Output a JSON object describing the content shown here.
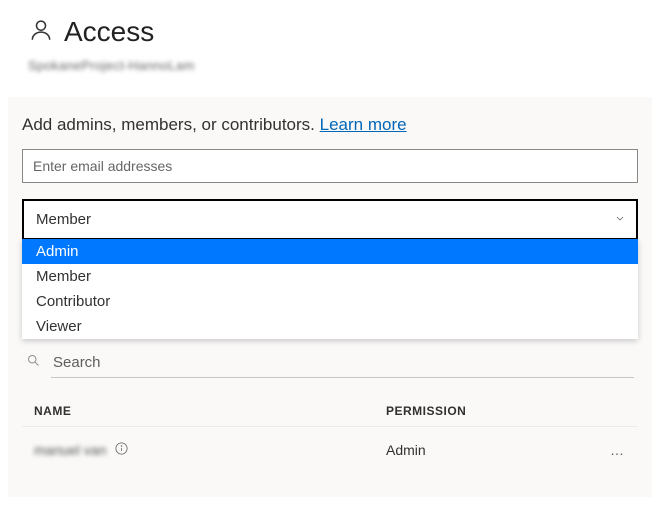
{
  "header": {
    "title": "Access",
    "subtitle": "SpokaneProject-HannoLam"
  },
  "panel": {
    "instruction_lead": "Add admins, members, or contributors. ",
    "learn_more": "Learn more",
    "email_placeholder": "Enter email addresses",
    "role_selected": "Member",
    "role_options": [
      "Admin",
      "Member",
      "Contributor",
      "Viewer"
    ],
    "role_highlight_index": 0,
    "search_placeholder": "Search"
  },
  "table": {
    "headers": {
      "name": "NAME",
      "permission": "PERMISSION"
    },
    "rows": [
      {
        "name": "manuel van",
        "permission": "Admin",
        "actions": "…"
      }
    ]
  }
}
